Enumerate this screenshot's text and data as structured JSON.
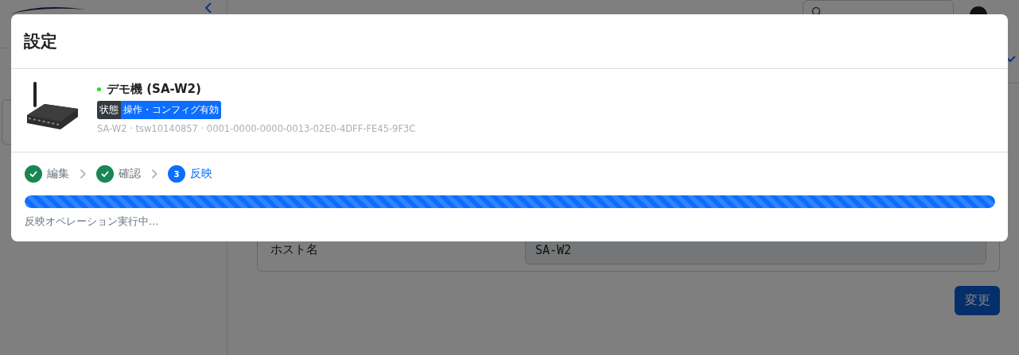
{
  "form": {
    "rows": [
      {
        "label": "ホスト名",
        "value": "SA-W2"
      }
    ],
    "submit": "変更"
  },
  "dialog": {
    "title": "設定",
    "device": {
      "name": "デモ機 (SA-W2)",
      "online": true,
      "status_label": "状態",
      "status_value": "操作・コンフィグ有効",
      "details": "SA-W2 · tsw10140857 · 0001-0000-0000-0013-02E0-4DFF-FE45-9F3C"
    },
    "steps": [
      {
        "label": "編集",
        "done": true,
        "current": false
      },
      {
        "label": "確認",
        "done": true,
        "current": false
      },
      {
        "label": "反映",
        "done": false,
        "current": true,
        "number": "3"
      }
    ],
    "progress": {
      "level": 1,
      "striped": true
    },
    "message": "反映オペレーション実行中..."
  }
}
